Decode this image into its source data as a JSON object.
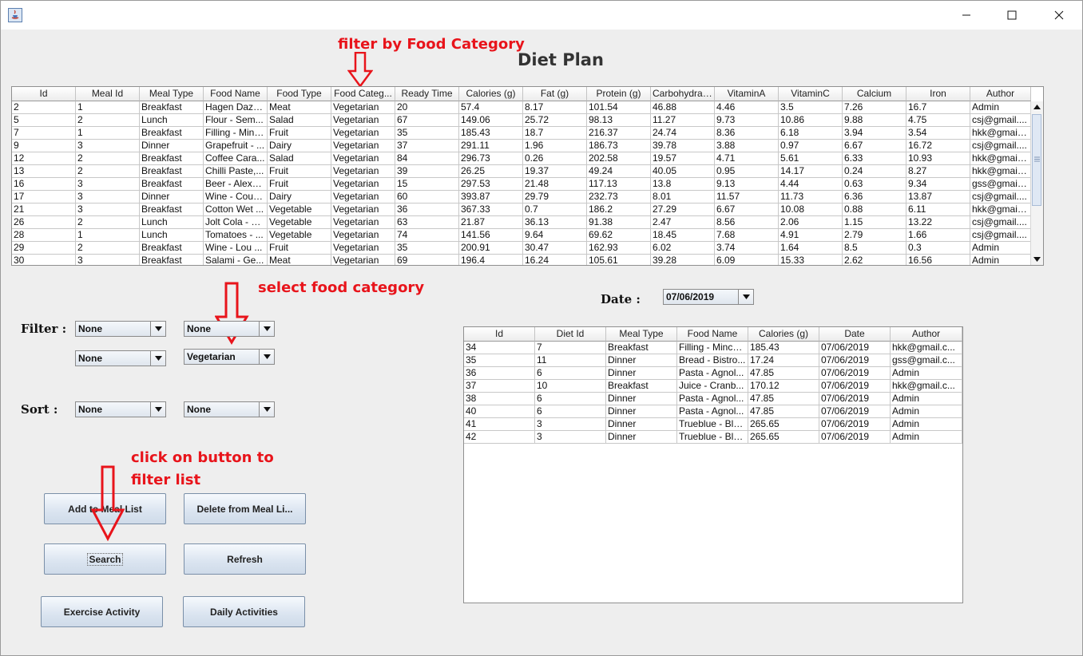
{
  "window": {
    "icon": "java-icon",
    "controls": [
      "minimize-icon",
      "maximize-icon",
      "close-icon"
    ]
  },
  "page_title": "Diet Plan",
  "annotations": {
    "filter_category": "filter by Food Category",
    "select_category": "select food category",
    "click_line1": "click on button to",
    "click_line2": "filter list"
  },
  "food_table": {
    "columns": [
      "Id",
      "Meal Id",
      "Meal Type",
      "Food Name",
      "Food Type",
      "Food Categ...",
      "Ready Time",
      "Calories (g)",
      "Fat (g)",
      "Protein (g)",
      "Carbohydrat...",
      "VitaminA",
      "VitaminC",
      "Calcium",
      "Iron",
      "Author"
    ],
    "rows": [
      [
        "2",
        "1",
        "Breakfast",
        "Hagen Daza...",
        "Meat",
        "Vegetarian",
        "20",
        "57.4",
        "8.17",
        "101.54",
        "46.88",
        "4.46",
        "3.5",
        "7.26",
        "16.7",
        "Admin"
      ],
      [
        "5",
        "2",
        "Lunch",
        "Flour - Sem...",
        "Salad",
        "Vegetarian",
        "67",
        "149.06",
        "25.72",
        "98.13",
        "11.27",
        "9.73",
        "10.86",
        "9.88",
        "4.75",
        "csj@gmail...."
      ],
      [
        "7",
        "1",
        "Breakfast",
        "Filling - Minc...",
        "Fruit",
        "Vegetarian",
        "35",
        "185.43",
        "18.7",
        "216.37",
        "24.74",
        "8.36",
        "6.18",
        "3.94",
        "3.54",
        "hkk@gmail...."
      ],
      [
        "9",
        "3",
        "Dinner",
        "Grapefruit - ...",
        "Dairy",
        "Vegetarian",
        "37",
        "291.11",
        "1.96",
        "186.73",
        "39.78",
        "3.88",
        "0.97",
        "6.67",
        "16.72",
        "csj@gmail...."
      ],
      [
        "12",
        "2",
        "Breakfast",
        "Coffee Cara...",
        "Salad",
        "Vegetarian",
        "84",
        "296.73",
        "0.26",
        "202.58",
        "19.57",
        "4.71",
        "5.61",
        "6.33",
        "10.93",
        "hkk@gmail...."
      ],
      [
        "13",
        "2",
        "Breakfast",
        "Chilli Paste,...",
        "Fruit",
        "Vegetarian",
        "39",
        "26.25",
        "19.37",
        "49.24",
        "40.05",
        "0.95",
        "14.17",
        "0.24",
        "8.27",
        "hkk@gmail...."
      ],
      [
        "16",
        "3",
        "Breakfast",
        "Beer - Alexa...",
        "Fruit",
        "Vegetarian",
        "15",
        "297.53",
        "21.48",
        "117.13",
        "13.8",
        "9.13",
        "4.44",
        "0.63",
        "9.34",
        "gss@gmail...."
      ],
      [
        "17",
        "3",
        "Dinner",
        "Wine - Cous...",
        "Dairy",
        "Vegetarian",
        "60",
        "393.87",
        "29.79",
        "232.73",
        "8.01",
        "11.57",
        "11.73",
        "6.36",
        "13.87",
        "csj@gmail...."
      ],
      [
        "21",
        "3",
        "Breakfast",
        "Cotton Wet ...",
        "Vegetable",
        "Vegetarian",
        "36",
        "367.33",
        "0.7",
        "186.2",
        "27.29",
        "6.67",
        "10.08",
        "0.88",
        "6.11",
        "hkk@gmail...."
      ],
      [
        "26",
        "2",
        "Lunch",
        "Jolt Cola - E...",
        "Vegetable",
        "Vegetarian",
        "63",
        "21.87",
        "36.13",
        "91.38",
        "2.47",
        "8.56",
        "2.06",
        "1.15",
        "13.22",
        "csj@gmail...."
      ],
      [
        "28",
        "1",
        "Lunch",
        "Tomatoes - ...",
        "Vegetable",
        "Vegetarian",
        "74",
        "141.56",
        "9.64",
        "69.62",
        "18.45",
        "7.68",
        "4.91",
        "2.79",
        "1.66",
        "csj@gmail...."
      ],
      [
        "29",
        "2",
        "Breakfast",
        "Wine - Lou ...",
        "Fruit",
        "Vegetarian",
        "35",
        "200.91",
        "30.47",
        "162.93",
        "6.02",
        "3.74",
        "1.64",
        "8.5",
        "0.3",
        "Admin"
      ],
      [
        "30",
        "3",
        "Breakfast",
        "Salami - Ge...",
        "Meat",
        "Vegetarian",
        "69",
        "196.4",
        "16.24",
        "105.61",
        "39.28",
        "6.09",
        "15.33",
        "2.62",
        "16.56",
        "Admin"
      ]
    ]
  },
  "date_label": "Date :",
  "date_value": "07/06/2019",
  "filter_label": "Filter :",
  "sort_label": "Sort :",
  "filters": {
    "filter1": "None",
    "filter2": "None",
    "filter3": "None",
    "filter4": "Vegetarian",
    "sort1": "None",
    "sort2": "None"
  },
  "buttons": {
    "add": "Add to Meal List",
    "delete": "Delete from Meal Li...",
    "search": "Search",
    "refresh": "Refresh",
    "exercise": "Exercise Activity",
    "daily": "Daily Activities"
  },
  "meal_table": {
    "columns": [
      "Id",
      "Diet Id",
      "Meal Type",
      "Food Name",
      "Calories (g)",
      "Date",
      "Author"
    ],
    "rows": [
      [
        "34",
        "7",
        "Breakfast",
        "Filling - Mince...",
        "185.43",
        "07/06/2019",
        "hkk@gmail.c..."
      ],
      [
        "35",
        "11",
        "Dinner",
        "Bread - Bistro...",
        "17.24",
        "07/06/2019",
        "gss@gmail.c..."
      ],
      [
        "36",
        "6",
        "Dinner",
        "Pasta - Agnol...",
        "47.85",
        "07/06/2019",
        "Admin"
      ],
      [
        "37",
        "10",
        "Breakfast",
        "Juice - Cranb...",
        "170.12",
        "07/06/2019",
        "hkk@gmail.c..."
      ],
      [
        "38",
        "6",
        "Dinner",
        "Pasta - Agnol...",
        "47.85",
        "07/06/2019",
        "Admin"
      ],
      [
        "40",
        "6",
        "Dinner",
        "Pasta - Agnol...",
        "47.85",
        "07/06/2019",
        "Admin"
      ],
      [
        "41",
        "3",
        "Dinner",
        "Trueblue - Blu...",
        "265.65",
        "07/06/2019",
        "Admin"
      ],
      [
        "42",
        "3",
        "Dinner",
        "Trueblue - Blu...",
        "265.65",
        "07/06/2019",
        "Admin"
      ]
    ]
  },
  "colors": {
    "annotation": "#e8141b",
    "window_bg": "#eeeeee"
  }
}
